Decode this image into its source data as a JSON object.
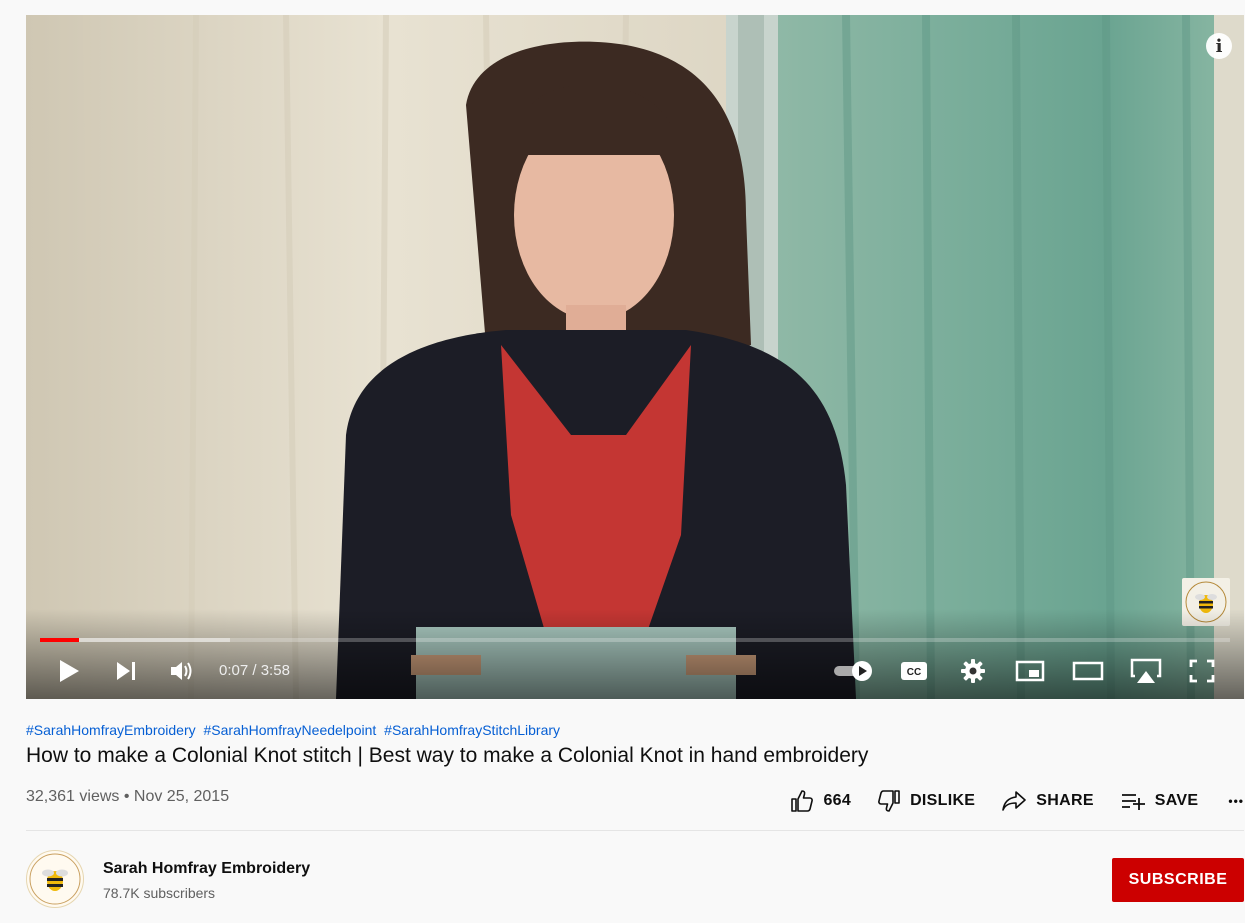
{
  "player": {
    "current_time": "0:07",
    "separator": "/",
    "duration": "3:58",
    "progress_played": 0.033,
    "progress_loaded": 0.16
  },
  "video": {
    "hashtags": [
      "#SarahHomfrayEmbroidery",
      "#SarahHomfrayNeedelpoint",
      "#SarahHomfrayStitchLibrary"
    ],
    "title": "How to make a Colonial Knot stitch | Best way to make a Colonial Knot in hand embroidery",
    "views": "32,361 views",
    "date_separator": "•",
    "date": "Nov 25, 2015"
  },
  "actions": {
    "like_count": "664",
    "dislike_label": "DISLIKE",
    "share_label": "SHARE",
    "save_label": "SAVE",
    "more_label": "•••"
  },
  "channel": {
    "name": "Sarah Homfray Embroidery",
    "subscribers": "78.7K subscribers",
    "subscribe_label": "SUBSCRIBE"
  },
  "colors": {
    "accent_red": "#cc0000",
    "progress_red": "#ff0000",
    "link_blue": "#065fd4"
  },
  "icons": [
    "play-icon",
    "next-icon",
    "volume-icon",
    "autoplay-toggle-icon",
    "captions-icon",
    "settings-icon",
    "miniplayer-icon",
    "theater-icon",
    "airplay-icon",
    "fullscreen-icon",
    "info-icon",
    "like-icon",
    "dislike-icon",
    "share-icon",
    "save-icon",
    "more-icon"
  ]
}
